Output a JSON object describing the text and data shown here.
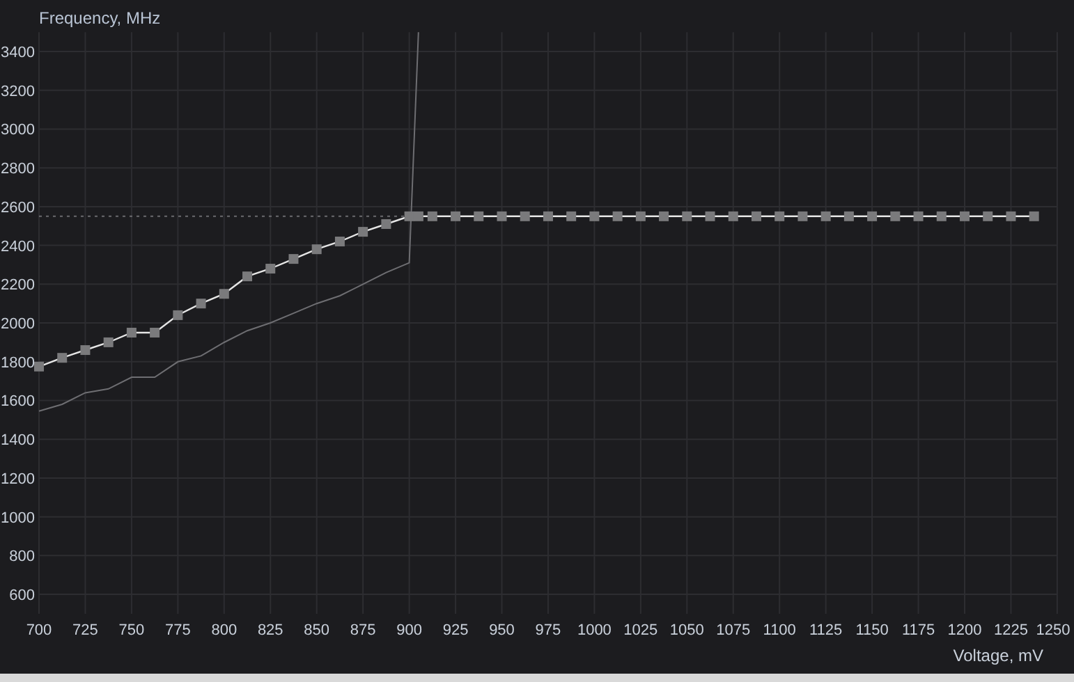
{
  "chart_data": {
    "type": "line",
    "xlabel": "Voltage, mV",
    "ylabel": "Frequency, MHz",
    "grid": true,
    "x": [
      700,
      712.5,
      725,
      737.5,
      750,
      762.5,
      775,
      787.5,
      800,
      812.5,
      825,
      837.5,
      850,
      862.5,
      875,
      887.5,
      900,
      905,
      912.5,
      925,
      937.5,
      950,
      962.5,
      975,
      987.5,
      1000,
      1012.5,
      1025,
      1037.5,
      1050,
      1062.5,
      1075,
      1087.5,
      1100,
      1112.5,
      1125,
      1137.5,
      1150,
      1162.5,
      1175,
      1187.5,
      1200,
      1212.5,
      1225,
      1237.5
    ],
    "series": [
      {
        "color": "#e6e6e6",
        "marker": "square",
        "values": [
          1775,
          1820,
          1860,
          1900,
          1950,
          1950,
          2040,
          2100,
          2150,
          2240,
          2280,
          2330,
          2380,
          2420,
          2470,
          2510,
          2550,
          2550,
          2550,
          2550,
          2550,
          2550,
          2550,
          2550,
          2550,
          2550,
          2550,
          2550,
          2550,
          2550,
          2550,
          2550,
          2550,
          2550,
          2550,
          2550,
          2550,
          2550,
          2550,
          2550,
          2550,
          2550,
          2550,
          2550,
          2550
        ]
      },
      {
        "color": "#6e6e72",
        "values": [
          1545,
          1580,
          1640,
          1660,
          1720,
          1720,
          1800,
          1830,
          1900,
          1960,
          2000,
          2050,
          2100,
          2140,
          2200,
          2260,
          2310,
          3500,
          null,
          null,
          null,
          null,
          null,
          null,
          null,
          null,
          null,
          null,
          null,
          null,
          null,
          null,
          null,
          null,
          null,
          null,
          null,
          null,
          null,
          null,
          null,
          null,
          null,
          null,
          null
        ]
      }
    ],
    "xlim": [
      700,
      1250
    ],
    "ylim": [
      500,
      3500
    ],
    "xticks": [
      700,
      725,
      750,
      775,
      800,
      825,
      850,
      875,
      900,
      925,
      950,
      975,
      1000,
      1025,
      1050,
      1075,
      1100,
      1125,
      1150,
      1175,
      1200,
      1225,
      1250
    ],
    "yticks": [
      600,
      800,
      1000,
      1200,
      1400,
      1600,
      1800,
      2000,
      2200,
      2400,
      2600,
      2800,
      3000,
      3200,
      3400
    ],
    "ref_lines": [
      {
        "axis": "y",
        "value": 2550
      }
    ]
  }
}
